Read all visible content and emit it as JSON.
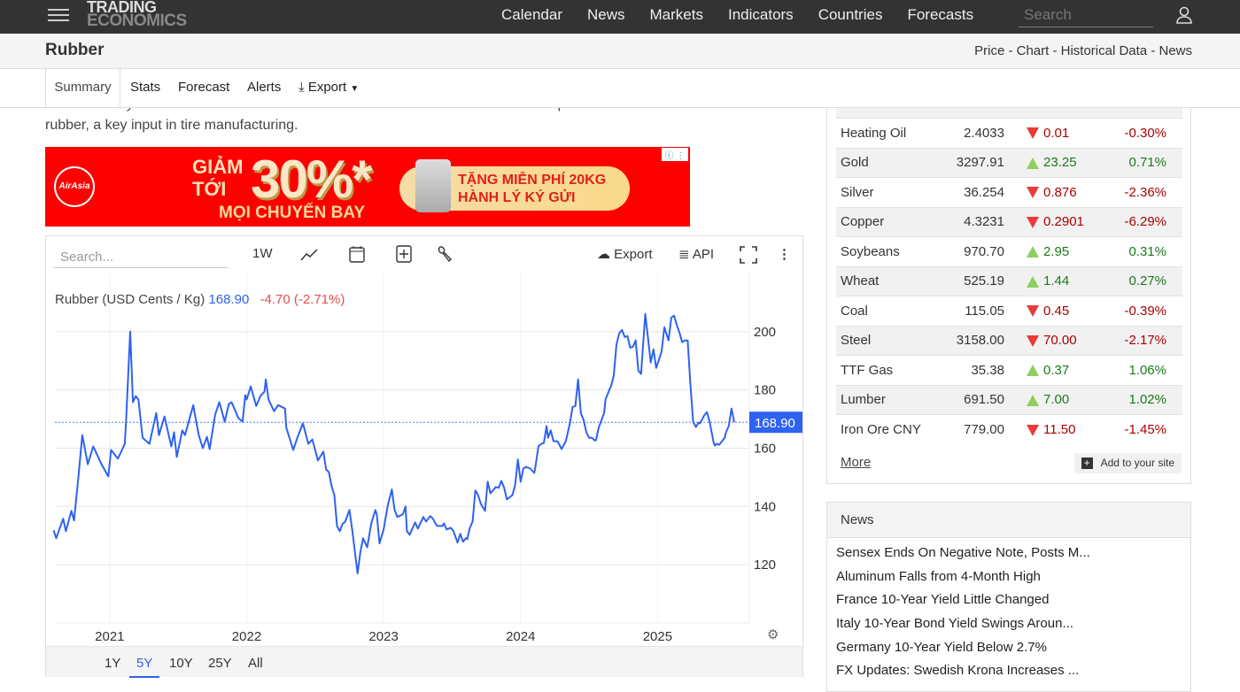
{
  "nav": {
    "logo_line1": "TRADING",
    "logo_line2": "ECONOMICS",
    "links": [
      "Calendar",
      "News",
      "Markets",
      "Indicators",
      "Countries",
      "Forecasts"
    ],
    "search_placeholder": "Search"
  },
  "header": {
    "title": "Rubber",
    "crumbs": "Price - Chart - Historical Data - News"
  },
  "tabs": [
    "Summary",
    "Stats",
    "Forecast",
    "Alerts",
    "Export"
  ],
  "article": {
    "cut_line": "broker Galaxy Futures said. This sustained momentum in vehicle sales could fuel production and raise demand for",
    "line": "rubber, a key input in tire manufacturing."
  },
  "ad": {
    "brand": "AirAsia",
    "l1": "GIẢM",
    "l2": "TỚI",
    "pct": "30%*",
    "l3": "MỌI CHUYẾN BAY",
    "p1": "TẶNG MIỄN PHÍ 20KG",
    "p2": "HÀNH LÝ KÝ GỬI"
  },
  "chart_toolbar": {
    "search_placeholder": "Search...",
    "interval": "1W",
    "export": "Export",
    "api": "API"
  },
  "chart_legend": {
    "name": "Rubber (USD Cents / Kg)",
    "value": "168.90",
    "change": "-4.70 (-2.71%)"
  },
  "ranges": [
    "1Y",
    "5Y",
    "10Y",
    "25Y",
    "All"
  ],
  "colors": {
    "line": "#2e62f0",
    "up": "#1a7a1a",
    "down": "#aa0000"
  },
  "chart_data": {
    "type": "line",
    "title": "Rubber (USD Cents / Kg)",
    "xlabel": "",
    "ylabel": "",
    "xlim": [
      2020.6,
      2025.67
    ],
    "ylim": [
      100,
      220
    ],
    "x_ticks": [
      "2021",
      "2022",
      "2023",
      "2024",
      "2025"
    ],
    "y_ticks": [
      "120",
      "140",
      "160",
      "180",
      "200"
    ],
    "last_label": "168.90",
    "last_value": 168.9,
    "grid": true,
    "series": [
      {
        "name": "Rubber",
        "points": [
          [
            2020.59,
            131.8
          ],
          [
            2020.61,
            129.1
          ],
          [
            2020.66,
            135.8
          ],
          [
            2020.68,
            131.5
          ],
          [
            2020.72,
            138.5
          ],
          [
            2020.74,
            135.2
          ],
          [
            2020.77,
            149.4
          ],
          [
            2020.8,
            164.5
          ],
          [
            2020.84,
            154.5
          ],
          [
            2020.88,
            160.6
          ],
          [
            2020.94,
            154.5
          ],
          [
            2020.99,
            150.3
          ],
          [
            2021.01,
            159.4
          ],
          [
            2021.06,
            156.4
          ],
          [
            2021.11,
            161.5
          ],
          [
            2021.12,
            169.7
          ],
          [
            2021.15,
            200.0
          ],
          [
            2021.17,
            175.8
          ],
          [
            2021.19,
            177.9
          ],
          [
            2021.21,
            176.7
          ],
          [
            2021.24,
            163.6
          ],
          [
            2021.29,
            161.5
          ],
          [
            2021.34,
            172.1
          ],
          [
            2021.36,
            164.5
          ],
          [
            2021.4,
            170.9
          ],
          [
            2021.45,
            160.6
          ],
          [
            2021.47,
            165.5
          ],
          [
            2021.49,
            157.0
          ],
          [
            2021.53,
            166.1
          ],
          [
            2021.55,
            164.5
          ],
          [
            2021.61,
            174.8
          ],
          [
            2021.62,
            172.1
          ],
          [
            2021.65,
            164.5
          ],
          [
            2021.68,
            160.0
          ],
          [
            2021.71,
            163.9
          ],
          [
            2021.73,
            159.7
          ],
          [
            2021.77,
            171.5
          ],
          [
            2021.8,
            175.8
          ],
          [
            2021.84,
            169.1
          ],
          [
            2021.87,
            175.2
          ],
          [
            2021.89,
            175.8
          ],
          [
            2021.94,
            170.3
          ],
          [
            2021.97,
            169.1
          ],
          [
            2021.99,
            178.2
          ],
          [
            2022.0,
            176.7
          ],
          [
            2022.03,
            181.2
          ],
          [
            2022.07,
            174.5
          ],
          [
            2022.1,
            177.9
          ],
          [
            2022.13,
            179.4
          ],
          [
            2022.14,
            183.6
          ],
          [
            2022.16,
            176.7
          ],
          [
            2022.2,
            172.7
          ],
          [
            2022.23,
            174.8
          ],
          [
            2022.28,
            173.6
          ],
          [
            2022.29,
            167.0
          ],
          [
            2022.34,
            159.4
          ],
          [
            2022.37,
            163.6
          ],
          [
            2022.41,
            168.5
          ],
          [
            2022.42,
            167.0
          ],
          [
            2022.45,
            161.5
          ],
          [
            2022.48,
            163.0
          ],
          [
            2022.52,
            155.8
          ],
          [
            2022.56,
            158.8
          ],
          [
            2022.58,
            152.7
          ],
          [
            2022.6,
            151.8
          ],
          [
            2022.62,
            147.0
          ],
          [
            2022.64,
            143.9
          ],
          [
            2022.66,
            133.3
          ],
          [
            2022.68,
            131.5
          ],
          [
            2022.7,
            134.0
          ],
          [
            2022.72,
            134.8
          ],
          [
            2022.75,
            138.8
          ],
          [
            2022.77,
            132.1
          ],
          [
            2022.81,
            117.0
          ],
          [
            2022.83,
            124.2
          ],
          [
            2022.85,
            129.1
          ],
          [
            2022.88,
            126.0
          ],
          [
            2022.91,
            134.2
          ],
          [
            2022.94,
            138.8
          ],
          [
            2022.95,
            137.3
          ],
          [
            2022.97,
            127.3
          ],
          [
            2023.0,
            132.1
          ],
          [
            2023.03,
            140.3
          ],
          [
            2023.06,
            145.8
          ],
          [
            2023.08,
            138.8
          ],
          [
            2023.1,
            136.4
          ],
          [
            2023.14,
            137.3
          ],
          [
            2023.16,
            140.0
          ],
          [
            2023.17,
            131.5
          ],
          [
            2023.19,
            130.3
          ],
          [
            2023.23,
            134.5
          ],
          [
            2023.25,
            132.4
          ],
          [
            2023.29,
            136.4
          ],
          [
            2023.31,
            134.8
          ],
          [
            2023.34,
            136.7
          ],
          [
            2023.36,
            135.8
          ],
          [
            2023.39,
            133.3
          ],
          [
            2023.43,
            133.3
          ],
          [
            2023.44,
            134.2
          ],
          [
            2023.46,
            132.1
          ],
          [
            2023.49,
            132.7
          ],
          [
            2023.51,
            131.5
          ],
          [
            2023.54,
            127.6
          ],
          [
            2023.56,
            130.6
          ],
          [
            2023.58,
            127.9
          ],
          [
            2023.6,
            129.1
          ],
          [
            2023.61,
            128.8
          ],
          [
            2023.63,
            132.7
          ],
          [
            2023.65,
            134.8
          ],
          [
            2023.67,
            145.5
          ],
          [
            2023.69,
            143.9
          ],
          [
            2023.71,
            140.9
          ],
          [
            2023.74,
            138.5
          ],
          [
            2023.76,
            148.5
          ],
          [
            2023.78,
            144.5
          ],
          [
            2023.82,
            146.7
          ],
          [
            2023.84,
            146.4
          ],
          [
            2023.86,
            148.8
          ],
          [
            2023.88,
            146.4
          ],
          [
            2023.9,
            142.4
          ],
          [
            2023.94,
            143.9
          ],
          [
            2023.96,
            147.3
          ],
          [
            2023.98,
            156.1
          ],
          [
            2024.0,
            148.5
          ],
          [
            2024.02,
            153.0
          ],
          [
            2024.04,
            153.6
          ],
          [
            2024.07,
            153.0
          ],
          [
            2024.1,
            151.5
          ],
          [
            2024.11,
            154.2
          ],
          [
            2024.13,
            160.6
          ],
          [
            2024.15,
            161.5
          ],
          [
            2024.17,
            161.8
          ],
          [
            2024.19,
            167.6
          ],
          [
            2024.2,
            163.6
          ],
          [
            2024.22,
            166.1
          ],
          [
            2024.24,
            162.4
          ],
          [
            2024.27,
            162.4
          ],
          [
            2024.3,
            159.7
          ],
          [
            2024.33,
            162.4
          ],
          [
            2024.36,
            168.5
          ],
          [
            2024.38,
            174.2
          ],
          [
            2024.4,
            174.5
          ],
          [
            2024.42,
            183.6
          ],
          [
            2024.44,
            172.1
          ],
          [
            2024.46,
            169.7
          ],
          [
            2024.48,
            165.5
          ],
          [
            2024.5,
            163.6
          ],
          [
            2024.52,
            163.6
          ],
          [
            2024.54,
            162.7
          ],
          [
            2024.55,
            162.7
          ],
          [
            2024.57,
            167.0
          ],
          [
            2024.61,
            172.1
          ],
          [
            2024.62,
            176.7
          ],
          [
            2024.65,
            180.3
          ],
          [
            2024.66,
            181.2
          ],
          [
            2024.68,
            184.8
          ],
          [
            2024.7,
            195.5
          ],
          [
            2024.72,
            199.4
          ],
          [
            2024.74,
            200.6
          ],
          [
            2024.76,
            198.2
          ],
          [
            2024.78,
            198.5
          ],
          [
            2024.8,
            194.5
          ],
          [
            2024.82,
            194.8
          ],
          [
            2024.84,
            197.0
          ],
          [
            2024.86,
            186.7
          ],
          [
            2024.88,
            185.5
          ],
          [
            2024.91,
            206.1
          ],
          [
            2024.93,
            197.9
          ],
          [
            2024.95,
            189.4
          ],
          [
            2024.97,
            193.9
          ],
          [
            2024.99,
            187.6
          ],
          [
            2025.01,
            190.3
          ],
          [
            2025.03,
            193.3
          ],
          [
            2025.05,
            201.5
          ],
          [
            2025.08,
            197.0
          ],
          [
            2025.1,
            204.8
          ],
          [
            2025.12,
            205.5
          ],
          [
            2025.14,
            202.4
          ],
          [
            2025.16,
            199.7
          ],
          [
            2025.18,
            196.4
          ],
          [
            2025.2,
            197.0
          ],
          [
            2025.22,
            197.0
          ],
          [
            2025.24,
            181.8
          ],
          [
            2025.26,
            169.1
          ],
          [
            2025.28,
            167.3
          ],
          [
            2025.3,
            168.8
          ],
          [
            2025.31,
            168.5
          ],
          [
            2025.34,
            171.2
          ],
          [
            2025.36,
            172.4
          ],
          [
            2025.38,
            169.1
          ],
          [
            2025.41,
            161.8
          ],
          [
            2025.42,
            160.9
          ],
          [
            2025.43,
            161.5
          ],
          [
            2025.45,
            161.2
          ],
          [
            2025.49,
            163.6
          ],
          [
            2025.5,
            165.5
          ],
          [
            2025.52,
            167.6
          ],
          [
            2025.54,
            173.6
          ],
          [
            2025.56,
            168.9
          ]
        ]
      }
    ]
  },
  "markets": {
    "rows": [
      {
        "name": "Heating Oil",
        "price": "2.4033",
        "change": "0.01",
        "pct": "-0.30%",
        "dir": "down"
      },
      {
        "name": "Gold",
        "price": "3297.91",
        "change": "23.25",
        "pct": "0.71%",
        "dir": "up"
      },
      {
        "name": "Silver",
        "price": "36.254",
        "change": "0.876",
        "pct": "-2.36%",
        "dir": "down"
      },
      {
        "name": "Copper",
        "price": "4.3231",
        "change": "0.2901",
        "pct": "-6.29%",
        "dir": "down"
      },
      {
        "name": "Soybeans",
        "price": "970.70",
        "change": "2.95",
        "pct": "0.31%",
        "dir": "up"
      },
      {
        "name": "Wheat",
        "price": "525.19",
        "change": "1.44",
        "pct": "0.27%",
        "dir": "up"
      },
      {
        "name": "Coal",
        "price": "115.05",
        "change": "0.45",
        "pct": "-0.39%",
        "dir": "down"
      },
      {
        "name": "Steel",
        "price": "3158.00",
        "change": "70.00",
        "pct": "-2.17%",
        "dir": "down"
      },
      {
        "name": "TTF Gas",
        "price": "35.38",
        "change": "0.37",
        "pct": "1.06%",
        "dir": "up"
      },
      {
        "name": "Lumber",
        "price": "691.50",
        "change": "7.00",
        "pct": "1.02%",
        "dir": "up"
      },
      {
        "name": "Iron Ore CNY",
        "price": "779.00",
        "change": "11.50",
        "pct": "-1.45%",
        "dir": "down"
      }
    ],
    "more": "More",
    "add": "Add to your site"
  },
  "news": {
    "title": "News",
    "items": [
      "Sensex Ends On Negative Note, Posts M...",
      "Aluminum Falls from 4-Month High",
      "France 10-Year Yield Little Changed",
      "Italy 10-Year Bond Yield Swings Aroun...",
      "Germany 10-Year Yield Below 2.7%",
      "FX Updates: Swedish Krona Increases ..."
    ]
  }
}
